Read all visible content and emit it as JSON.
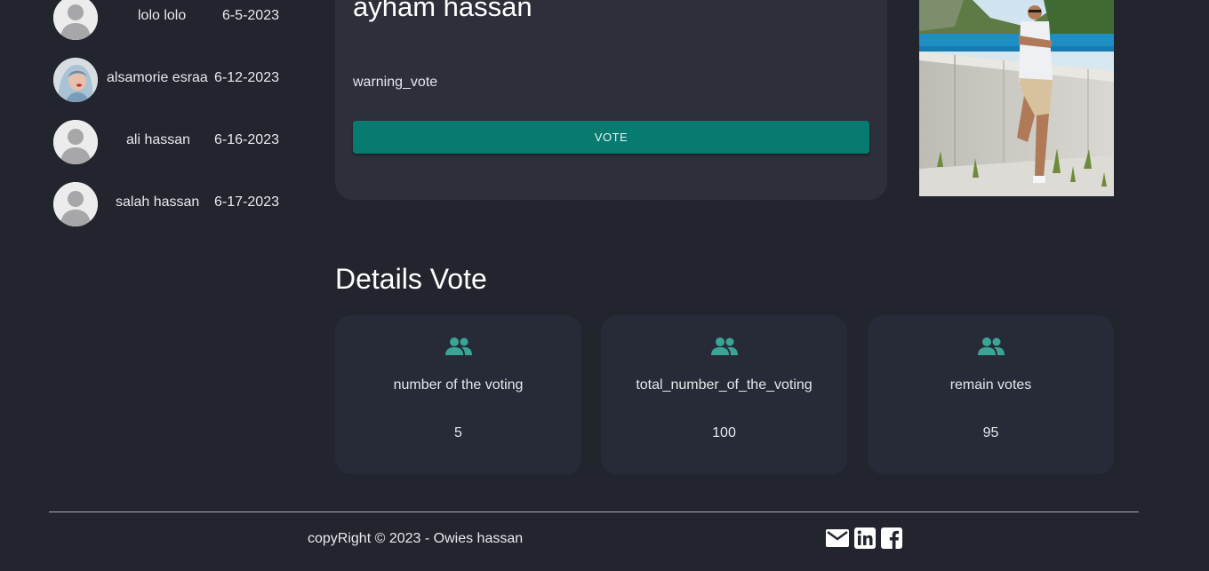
{
  "voters": [
    {
      "name": "lolo lolo",
      "date": "6-5-2023",
      "avatar": "default-avatar"
    },
    {
      "name": "alsamorie esraa",
      "date": "6-12-2023",
      "avatar": "user-photo"
    },
    {
      "name": "ali hassan",
      "date": "6-16-2023",
      "avatar": "default-avatar"
    },
    {
      "name": "salah hassan",
      "date": "6-17-2023",
      "avatar": "default-avatar"
    }
  ],
  "candidate": {
    "name": "ayham hassan",
    "warning": "warning_vote",
    "vote_button": "VOTE"
  },
  "details": {
    "title": "Details Vote",
    "stats": [
      {
        "label": "number of the voting",
        "value": "5",
        "icon": "group-icon"
      },
      {
        "label": "total_number_of_the_voting",
        "value": "100",
        "icon": "group-icon"
      },
      {
        "label": "remain votes",
        "value": "95",
        "icon": "group-icon"
      }
    ]
  },
  "footer": {
    "copyright": "copyRight © 2023 - Owies hassan",
    "socials": [
      "email-icon",
      "linkedin-icon",
      "facebook-icon"
    ]
  },
  "colors": {
    "background": "#22252e",
    "card": "#2d303b",
    "stat_card": "#272b38",
    "accent": "#087b70",
    "icon_accent": "#3aa596"
  }
}
